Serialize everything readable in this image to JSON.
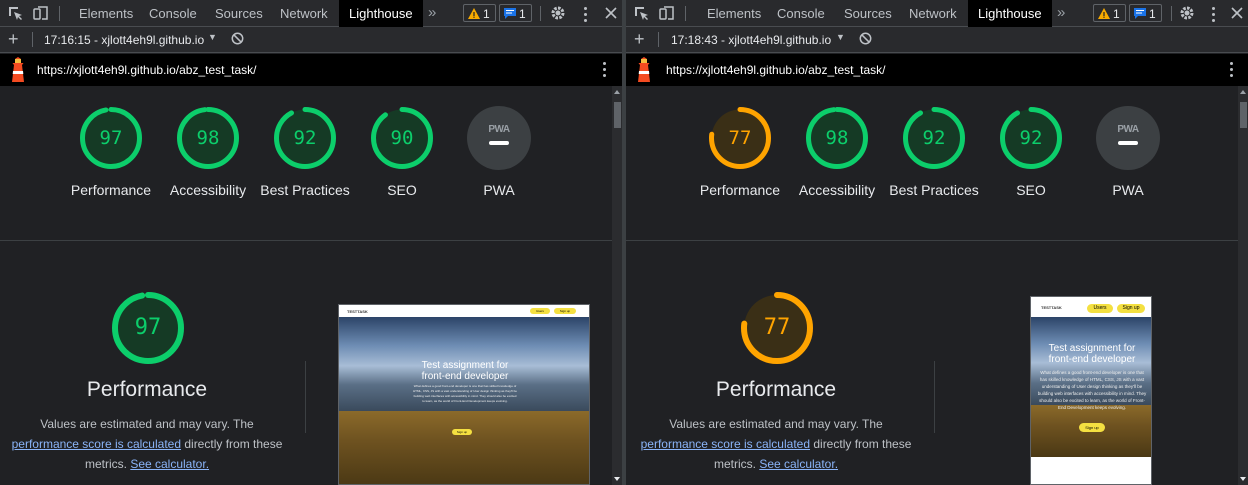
{
  "tabs": {
    "elements": "Elements",
    "console": "Console",
    "sources": "Sources",
    "network": "Network",
    "lighthouse": "Lighthouse",
    "more": "»"
  },
  "badges": {
    "warnings": "1",
    "messages": "1"
  },
  "panes": [
    {
      "run": "17:16:15 - xjlott4eh9l.github.io",
      "url": "https://xjlott4eh9l.github.io/abz_test_task/",
      "scores": [
        {
          "label": "Performance",
          "value": "97",
          "fraction": 0.97,
          "color": "#0cce6b"
        },
        {
          "label": "Accessibility",
          "value": "98",
          "fraction": 0.98,
          "color": "#0cce6b"
        },
        {
          "label": "Best Practices",
          "value": "92",
          "fraction": 0.92,
          "color": "#0cce6b"
        },
        {
          "label": "SEO",
          "value": "90",
          "fraction": 0.9,
          "color": "#0cce6b"
        }
      ],
      "pwa_label": "PWA",
      "pwa_badge": "PWA",
      "perf": {
        "value": "97",
        "fraction": 0.97,
        "color": "#0cce6b",
        "title": "Performance",
        "desc1": "Values are estimated and may vary. The",
        "link1": "performance score is calculated",
        "desc2": " directly from these",
        "desc3": "metrics. ",
        "link2": "See calculator."
      },
      "preview": {
        "brand": "TESTTASK",
        "users": "Users",
        "signup": "Sign up",
        "heading": "Test assignment for front-end developer",
        "para": "What defines a good front-end developer is one that has skilled knowledge of HTML, CSS, JS with a vast understanding of User design thinking as they'll be building web interfaces with accessibility in mind. They should also be excited to learn, as the world of Front-End Development keeps evolving.",
        "button": "Sign up"
      }
    },
    {
      "run": "17:18:43 - xjlott4eh9l.github.io",
      "url": "https://xjlott4eh9l.github.io/abz_test_task/",
      "scores": [
        {
          "label": "Performance",
          "value": "77",
          "fraction": 0.77,
          "color": "#ffa400"
        },
        {
          "label": "Accessibility",
          "value": "98",
          "fraction": 0.98,
          "color": "#0cce6b"
        },
        {
          "label": "Best Practices",
          "value": "92",
          "fraction": 0.92,
          "color": "#0cce6b"
        },
        {
          "label": "SEO",
          "value": "92",
          "fraction": 0.92,
          "color": "#0cce6b"
        }
      ],
      "pwa_label": "PWA",
      "pwa_badge": "PWA",
      "perf": {
        "value": "77",
        "fraction": 0.77,
        "color": "#ffa400",
        "title": "Performance",
        "desc1": "Values are estimated and may vary. The",
        "link1": "performance score is calculated",
        "desc2": " directly from these",
        "desc3": "metrics. ",
        "link2": "See calculator."
      },
      "preview": {
        "brand": "TESTTASK",
        "users": "Users",
        "signup": "Sign up",
        "heading": "Test assignment for front-end developer",
        "para": "What defines a good front-end developer is one that has skilled knowledge of HTML, CSS, JS with a vast understanding of User design thinking as they'll be building web interfaces with accessibility in mind. They should also be excited to learn, as the world of Front-End Development keeps evolving.",
        "button": "Sign up"
      }
    }
  ]
}
